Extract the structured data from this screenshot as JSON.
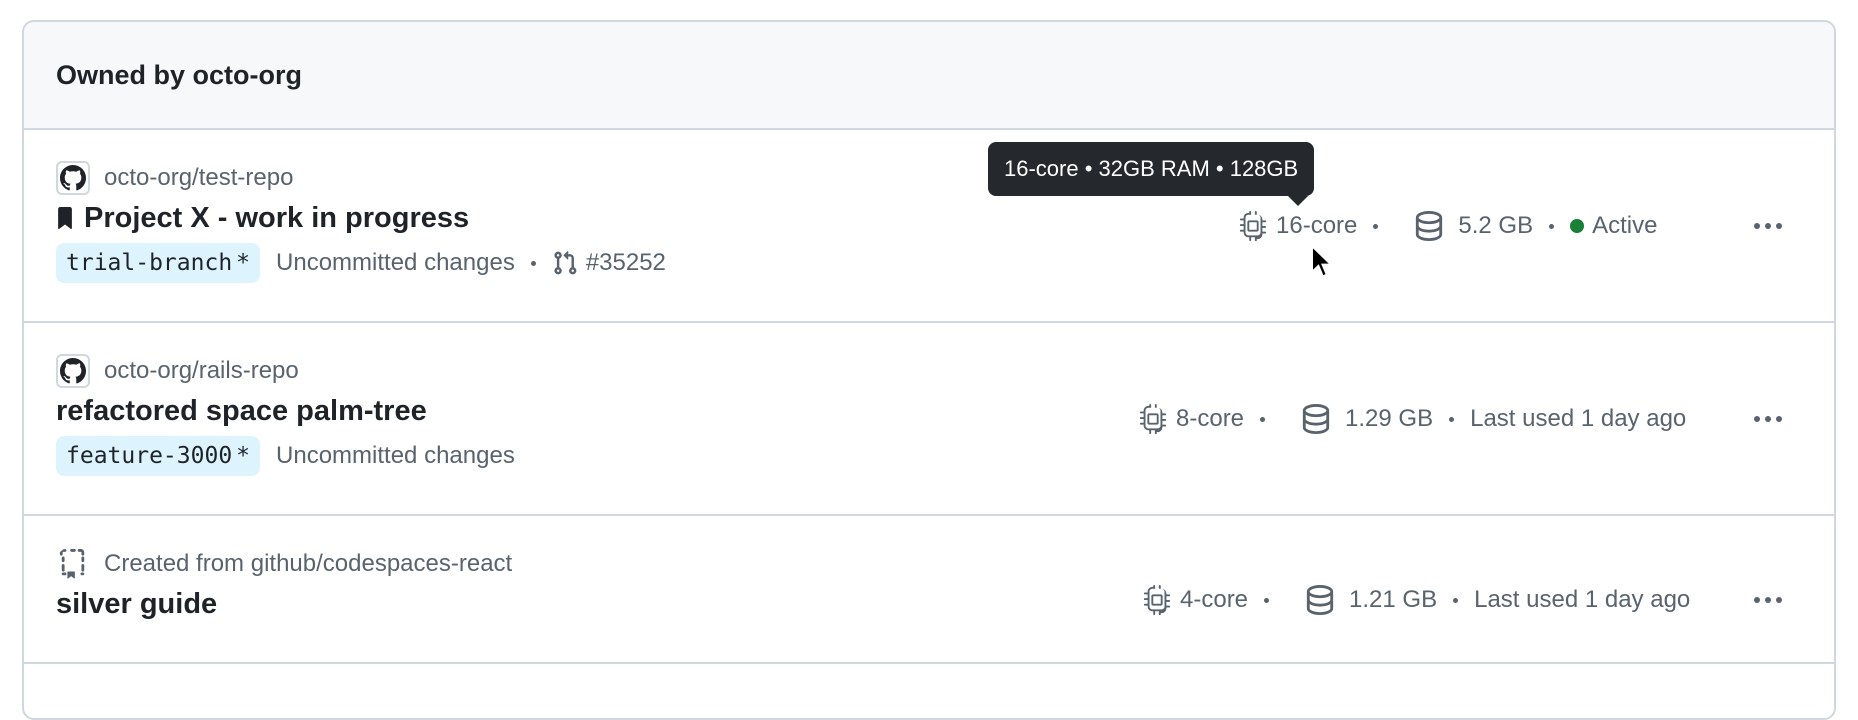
{
  "section": {
    "title": "Owned by octo-org"
  },
  "codespaces": [
    {
      "repo": "octo-org/test-repo",
      "name": "Project X - work in progress",
      "branch": "trial-branch",
      "branch_suffix": "*",
      "changes": "Uncommitted changes",
      "pr": "#35252",
      "machine": "16-core",
      "storage": "5.2 GB",
      "status": "Active",
      "status_color": "#1a7f37",
      "repo_icon": "github-mark-icon",
      "name_icon": "bookmark-icon"
    },
    {
      "repo": "octo-org/rails-repo",
      "name": "refactored space palm-tree",
      "branch": "feature-3000",
      "branch_suffix": "*",
      "changes": "Uncommitted changes",
      "machine": "8-core",
      "storage": "1.29 GB",
      "last_used": "Last used 1 day ago",
      "repo_icon": "github-mark-icon"
    },
    {
      "repo": "Created from github/codespaces-react",
      "name": "silver guide",
      "machine": "4-core",
      "storage": "1.21 GB",
      "last_used": "Last used 1 day ago",
      "repo_icon": "template-repo-icon"
    }
  ],
  "tooltip": {
    "text": "16-core • 32GB RAM • 128GB"
  },
  "colors": {
    "border": "#d0d7de",
    "header_bg": "#f6f8fa",
    "branch_bg": "#ddf4ff",
    "tooltip_bg": "#25292e",
    "muted_text": "#59636e"
  }
}
